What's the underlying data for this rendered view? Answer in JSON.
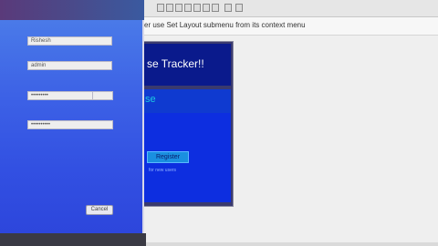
{
  "designer": {
    "hint": "er use Set Layout submenu from its context menu"
  },
  "preview": {
    "title": "se Tracker!!",
    "subtitle": "se",
    "register_label": "Register",
    "note": "for new users"
  },
  "login": {
    "username_value": "Rishesh",
    "admin_value": "admin",
    "password_value": "•••••••••",
    "confirm_value": "••••••••••",
    "cancel_label": "Cancel"
  }
}
